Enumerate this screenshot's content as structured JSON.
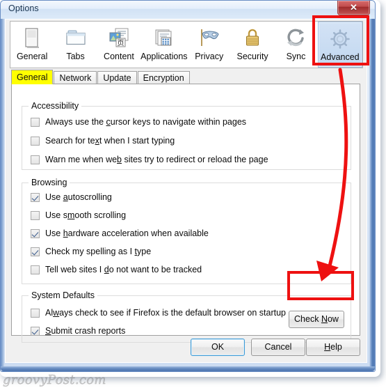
{
  "window": {
    "title": "Options",
    "close_label": "✕"
  },
  "toolbar": {
    "items": [
      {
        "label": "General",
        "icon": "general-page-icon",
        "selected": false
      },
      {
        "label": "Tabs",
        "icon": "tabs-folder-icon",
        "selected": false
      },
      {
        "label": "Content",
        "icon": "content-image-icon",
        "selected": false
      },
      {
        "label": "Applications",
        "icon": "applications-icon",
        "selected": false
      },
      {
        "label": "Privacy",
        "icon": "privacy-mask-icon",
        "selected": false
      },
      {
        "label": "Security",
        "icon": "security-lock-icon",
        "selected": false
      },
      {
        "label": "Sync",
        "icon": "sync-arrows-icon",
        "selected": false
      },
      {
        "label": "Advanced",
        "icon": "advanced-gear-icon",
        "selected": true
      }
    ]
  },
  "subtabs": {
    "items": [
      {
        "label": "General",
        "active": true
      },
      {
        "label": "Network",
        "active": false
      },
      {
        "label": "Update",
        "active": false
      },
      {
        "label": "Encryption",
        "active": false
      }
    ]
  },
  "groups": {
    "accessibility": {
      "title": "Accessibility",
      "options": [
        {
          "label_pre": "Always use the ",
          "accel": "c",
          "label_post": "ursor keys to navigate within pages",
          "checked": false
        },
        {
          "label_pre": "Search for te",
          "accel": "x",
          "label_post": "t when I start typing",
          "checked": false
        },
        {
          "label_pre": "Warn me when we",
          "accel": "b",
          "label_post": " sites try to redirect or reload the page",
          "checked": false
        }
      ]
    },
    "browsing": {
      "title": "Browsing",
      "options": [
        {
          "label_pre": "Use ",
          "accel": "a",
          "label_post": "utoscrolling",
          "checked": true
        },
        {
          "label_pre": "Use s",
          "accel": "m",
          "label_post": "ooth scrolling",
          "checked": false
        },
        {
          "label_pre": "Use ",
          "accel": "h",
          "label_post": "ardware acceleration when available",
          "checked": true
        },
        {
          "label_pre": "Check my spelling as I ",
          "accel": "t",
          "label_post": "ype",
          "checked": true
        },
        {
          "label_pre": "Tell web sites I ",
          "accel": "d",
          "label_post": "o not want to be tracked",
          "checked": false
        }
      ]
    },
    "system_defaults": {
      "title": "System Defaults",
      "options": [
        {
          "label_pre": "Al",
          "accel": "w",
          "label_post": "ays check to see if Firefox is the default browser on startup",
          "checked": false
        },
        {
          "label_pre": "",
          "accel": "S",
          "label_post": "ubmit crash reports",
          "checked": true
        }
      ],
      "check_now_pre": "Check ",
      "check_now_accel": "N",
      "check_now_post": "ow"
    }
  },
  "buttons": {
    "ok": "OK",
    "cancel": "Cancel",
    "help_pre": "",
    "help_accel": "H",
    "help_post": "elp"
  },
  "annotations": {
    "highlight_color": "#ee1111",
    "targets": [
      "advanced-toolbar-item",
      "check-now-button"
    ]
  },
  "watermark": "groovyPost.com"
}
